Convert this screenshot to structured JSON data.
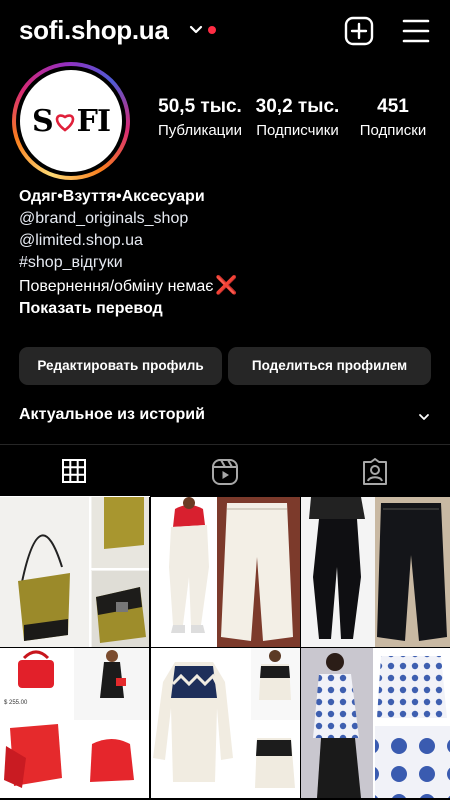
{
  "header": {
    "username": "sofi.shop.ua",
    "icons": {
      "dropdown": "chevron-down-icon",
      "add": "plus-square-icon",
      "menu": "hamburger-menu-icon"
    },
    "notification_dot_color": "#ff2d44"
  },
  "profile": {
    "logo_text": "SOFI",
    "stats": [
      {
        "value": "50,5 тыс.",
        "label": "Публикации"
      },
      {
        "value": "30,2 тыс.",
        "label": "Подписчики"
      },
      {
        "value": "451",
        "label": "Подписки"
      }
    ]
  },
  "bio": {
    "category": "Одяг•Взуття•Аксесуари",
    "lines": [
      "@brand_originals_shop",
      "@limited.shop.ua",
      "#shop_відгуки",
      "Повернення/обміну немає"
    ],
    "cross_emoji": "❌",
    "translate": "Показать перевод"
  },
  "actions": {
    "edit_profile": "Редактировать профиль",
    "share_profile": "Поделиться профилем"
  },
  "highlights": {
    "title": "Актуальное из историй"
  },
  "tabs": [
    {
      "icon": "grid-icon",
      "active": true
    },
    {
      "icon": "reels-icon",
      "active": false
    },
    {
      "icon": "tagged-person-icon",
      "active": false
    }
  ],
  "posts": [
    {
      "subject": "olive suede bucket bag"
    },
    {
      "subject": "white high-waist pants"
    },
    {
      "subject": "black wide-leg jeans"
    },
    {
      "subject": "red handbag",
      "price_text": "$ 255.00"
    },
    {
      "subject": "fair isle knit sweater"
    },
    {
      "subject": "blue polka dot shirt"
    }
  ],
  "colors": {
    "background": "#000000",
    "button": "#262626",
    "accent_red": "#f01f32"
  }
}
